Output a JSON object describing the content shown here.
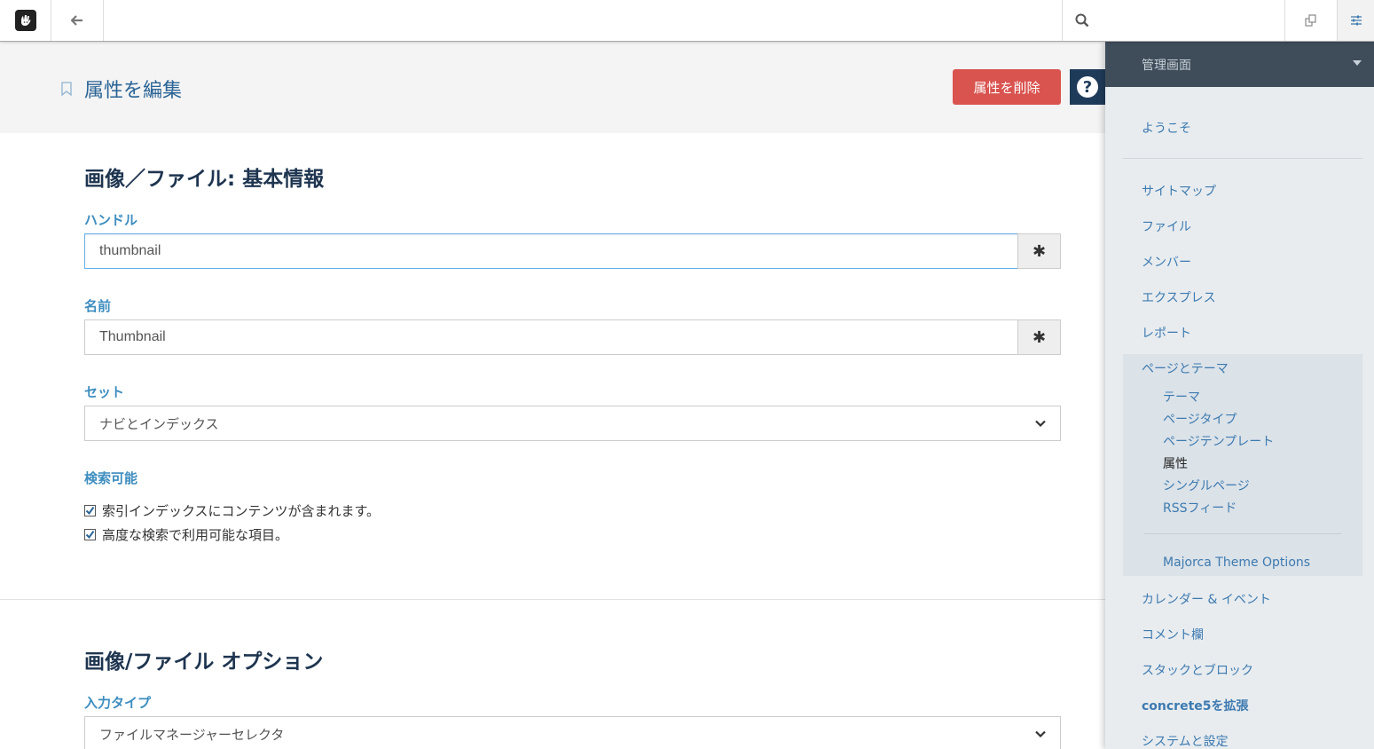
{
  "toolbar": {
    "logo_icon": "concrete5-hand-icon",
    "back_icon": "arrow-left-icon",
    "search_icon": "search-icon",
    "multilingual_icon": "copy-pages-icon",
    "settings_icon": "sliders-icon"
  },
  "header": {
    "title": "属性を編集",
    "delete_label": "属性を削除",
    "help_label": "?"
  },
  "basic_section": {
    "heading": "画像／ファイル: 基本情報",
    "handle_label": "ハンドル",
    "handle_value": "thumbnail",
    "name_label": "名前",
    "name_value": "Thumbnail",
    "required_marker": "✱",
    "set_label": "セット",
    "set_value": "ナビとインデックス",
    "searchable_label": "検索可能",
    "checkboxes": [
      {
        "label": "索引インデックスにコンテンツが含まれます。",
        "checked": true
      },
      {
        "label": "高度な検索で利用可能な項目。",
        "checked": true
      }
    ]
  },
  "options_section": {
    "heading": "画像/ファイル オプション",
    "input_type_label": "入力タイプ",
    "input_type_value": "ファイルマネージャーセレクタ"
  },
  "sidebar": {
    "title": "管理画面",
    "welcome": "ようこそ",
    "items": [
      {
        "label": "サイトマップ"
      },
      {
        "label": "ファイル"
      },
      {
        "label": "メンバー"
      },
      {
        "label": "エクスプレス"
      },
      {
        "label": "レポート"
      },
      {
        "label": "ページとテーマ"
      }
    ],
    "sub_items": [
      {
        "label": "テーマ"
      },
      {
        "label": "ページタイプ"
      },
      {
        "label": "ページテンプレート"
      },
      {
        "label": "属性",
        "active": true
      },
      {
        "label": "シングルページ"
      },
      {
        "label": "RSSフィード"
      }
    ],
    "theme_options": "Majorca Theme Options",
    "items_after": [
      {
        "label": "カレンダー & イベント"
      },
      {
        "label": "コメント欄"
      },
      {
        "label": "スタックとブロック"
      },
      {
        "label": "concrete5を拡張"
      },
      {
        "label": "システムと設定"
      }
    ]
  },
  "colors": {
    "accent": "#3d8dbf",
    "danger": "#d9534f",
    "panel_header": "#3f4d5a",
    "heading": "#1e3550"
  }
}
